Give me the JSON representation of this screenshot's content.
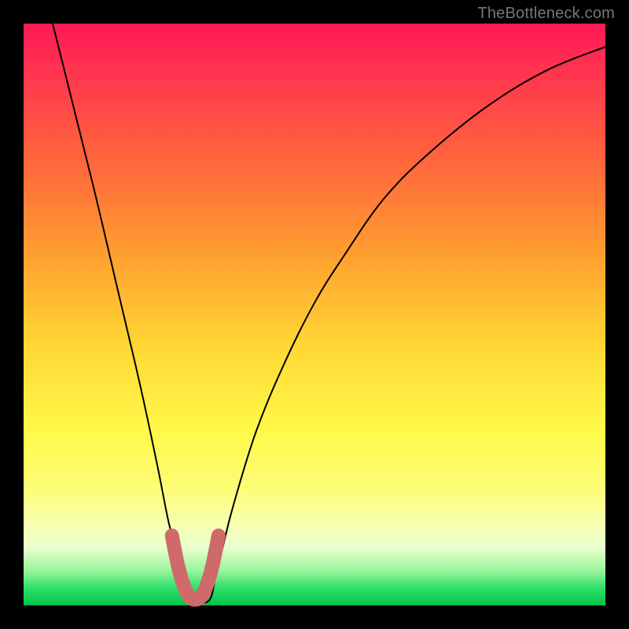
{
  "watermark": "TheBottleneck.com",
  "chart_data": {
    "type": "line",
    "title": "",
    "xlabel": "",
    "ylabel": "",
    "xlim": [
      0,
      100
    ],
    "ylim": [
      0,
      100
    ],
    "grid": false,
    "legend": false,
    "series": [
      {
        "name": "bottleneck-curve",
        "color": "#000000",
        "x": [
          5,
          8,
          12,
          16,
          20,
          23,
          25,
          26.5,
          28,
          30,
          32,
          33,
          34,
          36,
          40,
          45,
          50,
          55,
          62,
          70,
          80,
          90,
          100
        ],
        "y": [
          100,
          88,
          72,
          55,
          38,
          24,
          14,
          9,
          5,
          1,
          1,
          5,
          9,
          17,
          30,
          42,
          52,
          60,
          70,
          78,
          86,
          92,
          96
        ]
      },
      {
        "name": "valley-highlight",
        "color": "#cf6a6a",
        "x": [
          25.5,
          26.5,
          27.5,
          28.5,
          29.5,
          30.5,
          31.5,
          32.5,
          33.5
        ],
        "y": [
          12,
          7,
          3.5,
          1.5,
          1,
          1.5,
          3.5,
          7,
          12
        ]
      }
    ],
    "gradient_stops": [
      {
        "pos": 0,
        "color": "#ff1a56"
      },
      {
        "pos": 10,
        "color": "#ff3a4d"
      },
      {
        "pos": 25,
        "color": "#ff6a3a"
      },
      {
        "pos": 40,
        "color": "#ffa030"
      },
      {
        "pos": 55,
        "color": "#ffd633"
      },
      {
        "pos": 70,
        "color": "#fff94a"
      },
      {
        "pos": 80,
        "color": "#fdfd77"
      },
      {
        "pos": 86,
        "color": "#f7ffb0"
      },
      {
        "pos": 90,
        "color": "#e9ffd0"
      },
      {
        "pos": 94,
        "color": "#9cf59c"
      },
      {
        "pos": 97,
        "color": "#2de06a"
      },
      {
        "pos": 100,
        "color": "#06c24a"
      }
    ]
  }
}
